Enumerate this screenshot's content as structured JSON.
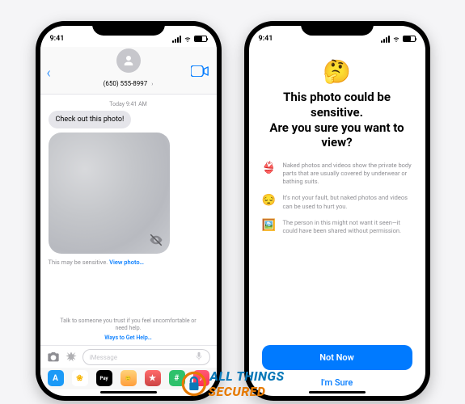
{
  "status": {
    "time": "9:41"
  },
  "left": {
    "contact": "(650) 555-8997",
    "timestamp": "Today 9:41 AM",
    "bubble_text": "Check out this photo!",
    "caption_label": "This may be sensitive.",
    "caption_link": "View photo…",
    "help_text": "Talk to someone you trust if you feel uncomfortable or need help.",
    "help_link": "Ways to Get Help…",
    "compose_placeholder": "iMessage",
    "drawer_apps": [
      {
        "name": "store",
        "bg": "#1b9af7",
        "glyph": "A"
      },
      {
        "name": "photos",
        "bg": "#fff",
        "glyph": "❀"
      },
      {
        "name": "applepay",
        "bg": "#000",
        "glyph": "Pay"
      },
      {
        "name": "memoji",
        "bg": "linear-gradient(#ffd37a,#ff9d3b)",
        "glyph": "🙂"
      },
      {
        "name": "stickers",
        "bg": "linear-gradient(#ff6b6b,#c44)",
        "glyph": "★"
      },
      {
        "name": "hashtag",
        "bg": "#2ec16b",
        "glyph": "#"
      },
      {
        "name": "music",
        "bg": "linear-gradient(#ff5b74,#ff2d55)",
        "glyph": "♪"
      }
    ]
  },
  "right": {
    "emoji": "🤔",
    "headline_line1": "This photo could be sensitive.",
    "headline_line2": "Are you sure you want to view?",
    "reasons": [
      {
        "emoji": "👙",
        "text": "Naked photos and videos show the private body parts that are usually covered by underwear or bathing suits."
      },
      {
        "emoji": "😔",
        "text": "It's not your fault, but naked photos and videos can be used to hurt you."
      },
      {
        "emoji": "🖼️",
        "text": "The person in this might not want it seen—it could have been shared without permission."
      }
    ],
    "primary_label": "Not Now",
    "secondary_label": "I'm Sure"
  },
  "watermark": {
    "t1": "ALL THINGS",
    "t2": "SECURED"
  }
}
